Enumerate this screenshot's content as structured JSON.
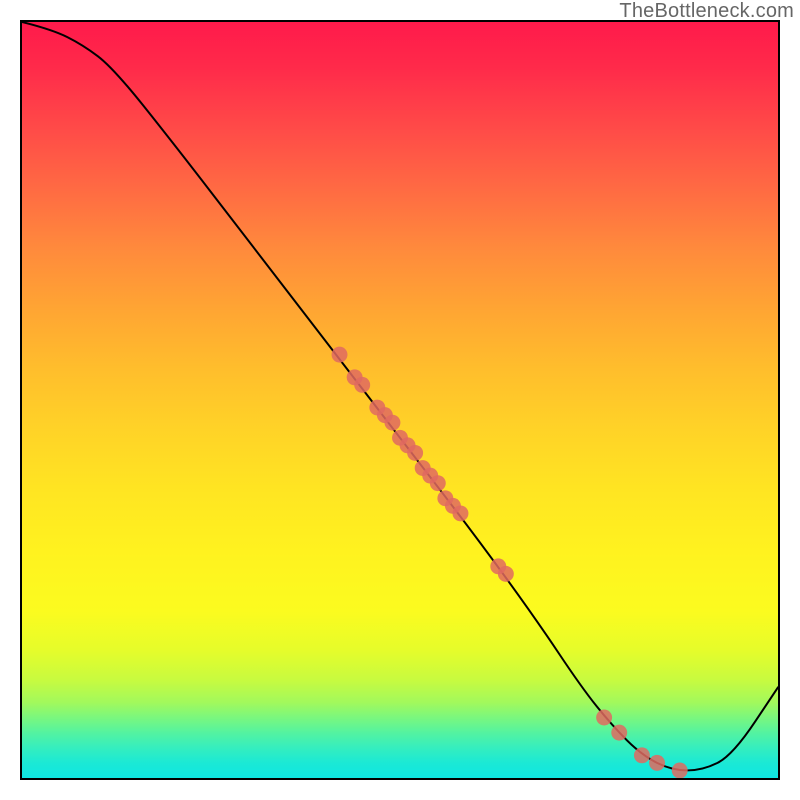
{
  "watermark": "TheBottleneck.com",
  "chart_data": {
    "type": "line",
    "title": "",
    "xlabel": "",
    "ylabel": "",
    "xlim": [
      0,
      100
    ],
    "ylim": [
      0,
      100
    ],
    "series": [
      {
        "name": "bottleneck-curve",
        "x": [
          0,
          4,
          8,
          12,
          20,
          30,
          40,
          50,
          60,
          68,
          74,
          78,
          82,
          86,
          90,
          94,
          100
        ],
        "y": [
          100,
          99,
          97,
          94,
          84,
          71,
          58,
          45,
          32,
          21,
          12,
          7,
          3,
          1,
          1,
          3,
          12
        ]
      }
    ],
    "highlight_points": {
      "name": "marked-points",
      "x": [
        42,
        44,
        45,
        47,
        48,
        49,
        50,
        51,
        52,
        53,
        54,
        55,
        56,
        57,
        58,
        63,
        64,
        77,
        79,
        82,
        84,
        87
      ],
      "y": [
        56,
        53,
        52,
        49,
        48,
        47,
        45,
        44,
        43,
        41,
        40,
        39,
        37,
        36,
        35,
        28,
        27,
        8,
        6,
        3,
        2,
        1
      ]
    },
    "gradient_stops": [
      {
        "pos": 0,
        "color": "#ff1a4b"
      },
      {
        "pos": 50,
        "color": "#ffd327"
      },
      {
        "pos": 80,
        "color": "#fbfb1f"
      },
      {
        "pos": 100,
        "color": "#0fe6e2"
      }
    ]
  }
}
